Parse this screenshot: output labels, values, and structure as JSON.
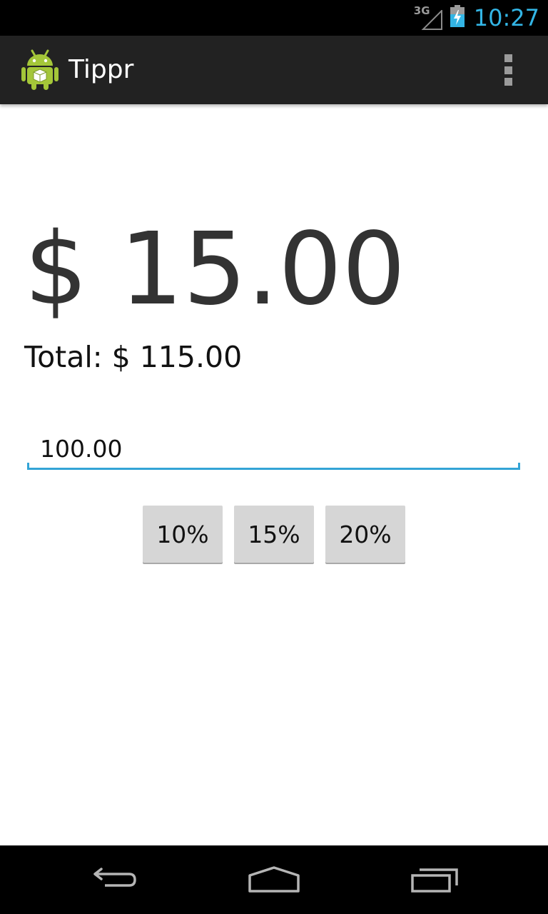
{
  "status_bar": {
    "network_label": "3G",
    "time": "10:27",
    "clock_color": "#33b5e5",
    "icons": [
      "signal-icon",
      "battery-charging-icon"
    ]
  },
  "action_bar": {
    "title": "Tippr",
    "app_icon": "android-robot-icon",
    "overflow_icon": "overflow-menu-icon"
  },
  "main": {
    "tip_amount": "$ 15.00",
    "total_text": "Total: $ 115.00",
    "bill_input": {
      "value": "100.00"
    },
    "tip_buttons": [
      {
        "label": "10%"
      },
      {
        "label": "15%"
      },
      {
        "label": "20%"
      }
    ],
    "accent_color": "#33a4d6"
  },
  "nav_bar": {
    "icons": [
      "back-icon",
      "home-icon",
      "recent-apps-icon"
    ]
  }
}
